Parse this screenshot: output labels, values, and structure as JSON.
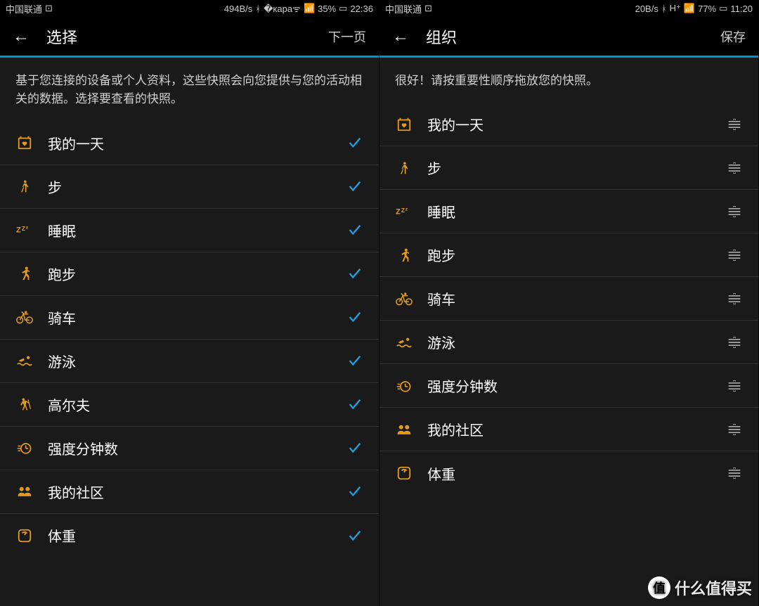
{
  "accent": "#e29a1f",
  "check_color": "#1fa0e0",
  "left": {
    "status": {
      "carrier": "中国联通",
      "speed": "494B/s",
      "battery": "35%",
      "time": "22:36"
    },
    "title": "选择",
    "action": "下一页",
    "description": "基于您连接的设备或个人资料，这些快照会向您提供与您的活动相关的数据。选择要查看的快照。",
    "items": [
      {
        "label": "我的一天",
        "icon": "calendar-heart"
      },
      {
        "label": "步",
        "icon": "walk"
      },
      {
        "label": "睡眠",
        "icon": "sleep"
      },
      {
        "label": "跑步",
        "icon": "run"
      },
      {
        "label": "骑车",
        "icon": "cycle"
      },
      {
        "label": "游泳",
        "icon": "swim"
      },
      {
        "label": "高尔夫",
        "icon": "golf"
      },
      {
        "label": "强度分钟数",
        "icon": "intensity"
      },
      {
        "label": "我的社区",
        "icon": "community"
      },
      {
        "label": "体重",
        "icon": "weight"
      }
    ]
  },
  "right": {
    "status": {
      "carrier": "中国联通",
      "speed": "20B/s",
      "battery": "77%",
      "time": "11:20"
    },
    "title": "组织",
    "action": "保存",
    "description": "很好！请按重要性顺序拖放您的快照。",
    "items": [
      {
        "label": "我的一天",
        "icon": "calendar-heart"
      },
      {
        "label": "步",
        "icon": "walk"
      },
      {
        "label": "睡眠",
        "icon": "sleep"
      },
      {
        "label": "跑步",
        "icon": "run"
      },
      {
        "label": "骑车",
        "icon": "cycle"
      },
      {
        "label": "游泳",
        "icon": "swim"
      },
      {
        "label": "强度分钟数",
        "icon": "intensity"
      },
      {
        "label": "我的社区",
        "icon": "community"
      },
      {
        "label": "体重",
        "icon": "weight"
      }
    ]
  },
  "watermark": "什么值得买"
}
